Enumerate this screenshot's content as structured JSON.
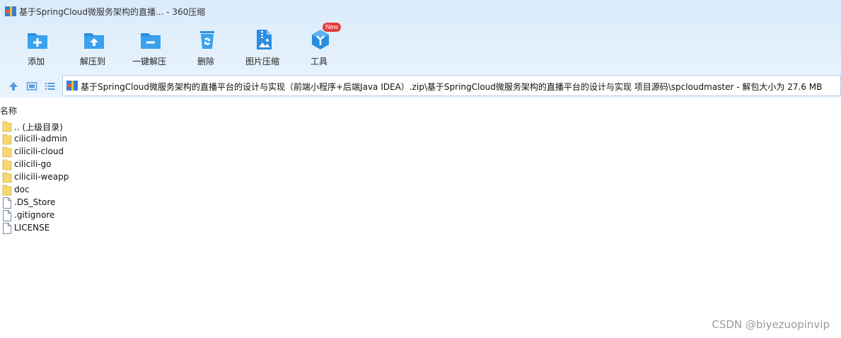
{
  "window": {
    "title": "基于SpringCloud微服务架构的直播... - 360压缩"
  },
  "toolbar": {
    "buttons": [
      {
        "label": "添加",
        "icon": "add-icon"
      },
      {
        "label": "解压到",
        "icon": "extract-to-icon"
      },
      {
        "label": "一键解压",
        "icon": "one-click-extract-icon"
      },
      {
        "label": "删除",
        "icon": "delete-icon"
      },
      {
        "label": "图片压缩",
        "icon": "image-compress-icon"
      },
      {
        "label": "工具",
        "icon": "tools-icon",
        "badge": "New"
      }
    ]
  },
  "nav": {
    "path": "基于SpringCloud微服务架构的直播平台的设计与实现（前端小程序+后端Java IDEA）.zip\\基于SpringCloud微服务架构的直播平台的设计与实现 项目源码\\spcloudmaster - 解包大小为 27.6 MB"
  },
  "list": {
    "column_name": "名称",
    "items": [
      {
        "name": ".. (上级目录)",
        "type": "folder"
      },
      {
        "name": "cilicili-admin",
        "type": "folder"
      },
      {
        "name": "cilicili-cloud",
        "type": "folder"
      },
      {
        "name": "cilicili-go",
        "type": "folder"
      },
      {
        "name": "cilicili-weapp",
        "type": "folder"
      },
      {
        "name": "doc",
        "type": "folder"
      },
      {
        "name": ".DS_Store",
        "type": "file"
      },
      {
        "name": ".gitignore",
        "type": "file"
      },
      {
        "name": "LICENSE",
        "type": "file"
      }
    ]
  },
  "watermark": "CSDN @biyezuopinvip",
  "colors": {
    "accent": "#2a8ee0",
    "badge": "#e83b3b",
    "folder": "#f7d772"
  }
}
